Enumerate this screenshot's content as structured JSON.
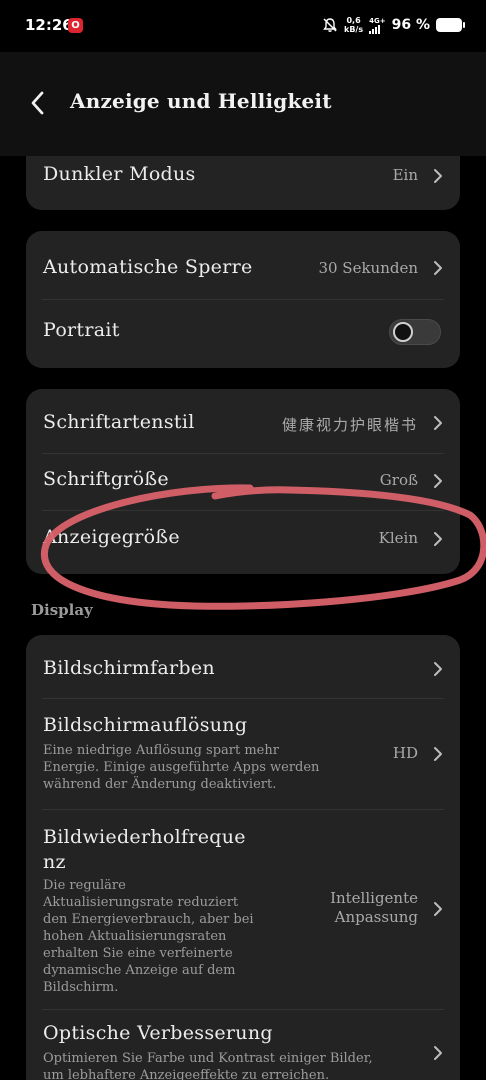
{
  "status_bar": {
    "time": "12:26",
    "app_badge": "O",
    "speed_value": "0,6",
    "speed_unit": "kB/s",
    "network": "4G+",
    "battery": "96 %"
  },
  "header": {
    "title": "Anzeige und Helligkeit"
  },
  "dark_mode": {
    "label": "Dunkler Modus",
    "value": "Ein"
  },
  "lock": {
    "auto_lock_label": "Automatische Sperre",
    "auto_lock_value": "30 Sekunden",
    "portrait_label": "Portrait",
    "portrait_enabled": false
  },
  "fonts": {
    "style_label": "Schriftartenstil",
    "style_value": "健康视力护眼楷书",
    "size_label": "Schriftgröße",
    "size_value": "Groß",
    "display_size_label": "Anzeigegröße",
    "display_size_value": "Klein"
  },
  "display_section": {
    "header": "Display",
    "colors_label": "Bildschirmfarben",
    "resolution_label": "Bildschirmauflösung",
    "resolution_desc_1": "Eine niedrige Auflösung spart mehr",
    "resolution_desc_2": "Energie. Einige ausgeführte Apps werden",
    "resolution_desc_3": "während der Änderung deaktiviert.",
    "resolution_value": "HD",
    "refresh_label_1": "Bildwiederholfreque",
    "refresh_label_2": "nz",
    "refresh_desc_1": "Die reguläre",
    "refresh_desc_2": "Aktualisierungsrate reduziert",
    "refresh_desc_3": "den Energieverbrauch, aber bei",
    "refresh_desc_4": "hohen Aktualisierungsraten",
    "refresh_desc_5": "erhalten Sie eine verfeinerte",
    "refresh_desc_6": "dynamische Anzeige auf dem",
    "refresh_desc_7": "Bildschirm.",
    "refresh_value_1": "Intelligente",
    "refresh_value_2": "Anpassung",
    "optical_label": "Optische Verbesserung",
    "optical_desc_1": "Optimieren Sie Farbe und Kontrast einiger Bilder,",
    "optical_desc_2": "um lebhaftere Anzeigeeffekte zu erreichen."
  },
  "colors": {
    "background": "#000000",
    "card": "#232323",
    "annotation_stroke": "#d9626a"
  }
}
